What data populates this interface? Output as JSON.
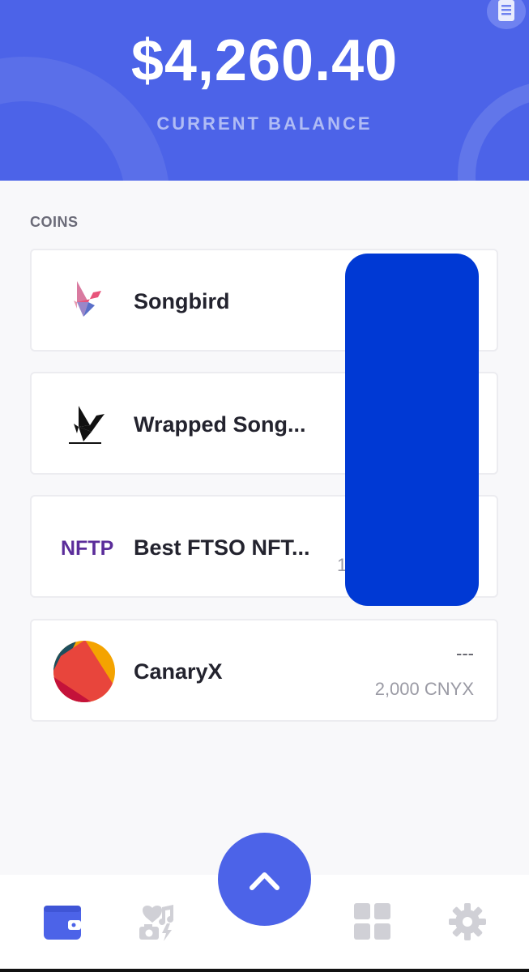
{
  "header": {
    "balance": "$4,260.40",
    "balance_label": "CURRENT BALANCE",
    "accent_color": "#4c63e8",
    "corner_icon": "receipt-icon"
  },
  "coins_section": {
    "title": "COINS",
    "items": [
      {
        "name": "Songbird",
        "icon": "songbird-logo",
        "value": "",
        "amount": ""
      },
      {
        "name": "Wrapped Song...",
        "icon": "wrapped-songbird-logo",
        "value": "",
        "amount": ""
      },
      {
        "name": "Best FTSO NFT...",
        "icon": "nftp-logo",
        "logo_text": "NFTP",
        "value": "",
        "amount": "1"
      },
      {
        "name": "CanaryX",
        "icon": "canaryx-logo",
        "value": "---",
        "amount": "2,000 CNYX"
      }
    ]
  },
  "redaction": {
    "color": "#0039d4"
  },
  "bottom_nav": {
    "items": [
      {
        "icon": "wallet-icon",
        "active": true
      },
      {
        "icon": "media-collectibles-icon",
        "active": false
      },
      {
        "icon": "chevron-up-icon",
        "active": false
      },
      {
        "icon": "apps-grid-icon",
        "active": false
      },
      {
        "icon": "gear-icon",
        "active": false
      }
    ]
  }
}
